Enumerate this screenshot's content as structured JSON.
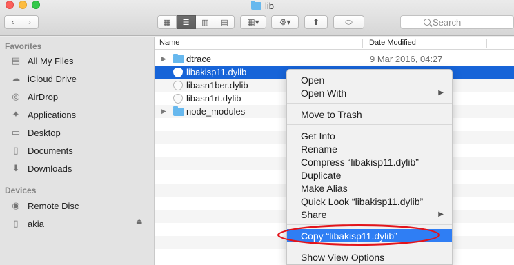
{
  "window": {
    "title": "lib"
  },
  "toolbar": {
    "back_icon": "‹",
    "forward_icon": "›",
    "view_icons": [
      "▦",
      "☰",
      "▥",
      "▤"
    ],
    "arrange_icon": "▦▾",
    "action_icon": "⚙▾",
    "share_icon": "⬆",
    "tag_icon": "⬭",
    "search_placeholder": "Search"
  },
  "sidebar": {
    "favorites_label": "Favorites",
    "favorites": [
      {
        "label": "All My Files",
        "icon": "▤"
      },
      {
        "label": "iCloud Drive",
        "icon": "☁"
      },
      {
        "label": "AirDrop",
        "icon": "◎"
      },
      {
        "label": "Applications",
        "icon": "✦"
      },
      {
        "label": "Desktop",
        "icon": "▭"
      },
      {
        "label": "Documents",
        "icon": "▯"
      },
      {
        "label": "Downloads",
        "icon": "⬇"
      }
    ],
    "devices_label": "Devices",
    "devices": [
      {
        "label": "Remote Disc",
        "icon": "◉"
      },
      {
        "label": "akia",
        "icon": "▯"
      }
    ],
    "eject_icon": "⏏"
  },
  "list": {
    "col_name": "Name",
    "col_date": "Date Modified",
    "rows": [
      {
        "name": "dtrace",
        "date": "9 Mar 2016, 04:27",
        "type": "folder"
      },
      {
        "name": "libakisp11.dylib",
        "date": "",
        "type": "file",
        "selected": true
      },
      {
        "name": "libasn1ber.dylib",
        "date": "",
        "type": "file"
      },
      {
        "name": "libasn1rt.dylib",
        "date": "",
        "type": "file"
      },
      {
        "name": "node_modules",
        "date": "",
        "type": "folder"
      }
    ]
  },
  "context_menu": {
    "items": [
      {
        "label": "Open"
      },
      {
        "label": "Open With",
        "submenu": true
      },
      {
        "label": "Move to Trash"
      },
      {
        "label": "Get Info"
      },
      {
        "label": "Rename"
      },
      {
        "label": "Compress “libakisp11.dylib”"
      },
      {
        "label": "Duplicate"
      },
      {
        "label": "Make Alias"
      },
      {
        "label": "Quick Look “libakisp11.dylib”"
      },
      {
        "label": "Share",
        "submenu": true
      },
      {
        "label": "Copy “libakisp11.dylib”",
        "highlighted": true
      },
      {
        "label": "Show View Options"
      }
    ],
    "submenu_arrow": "▶"
  }
}
